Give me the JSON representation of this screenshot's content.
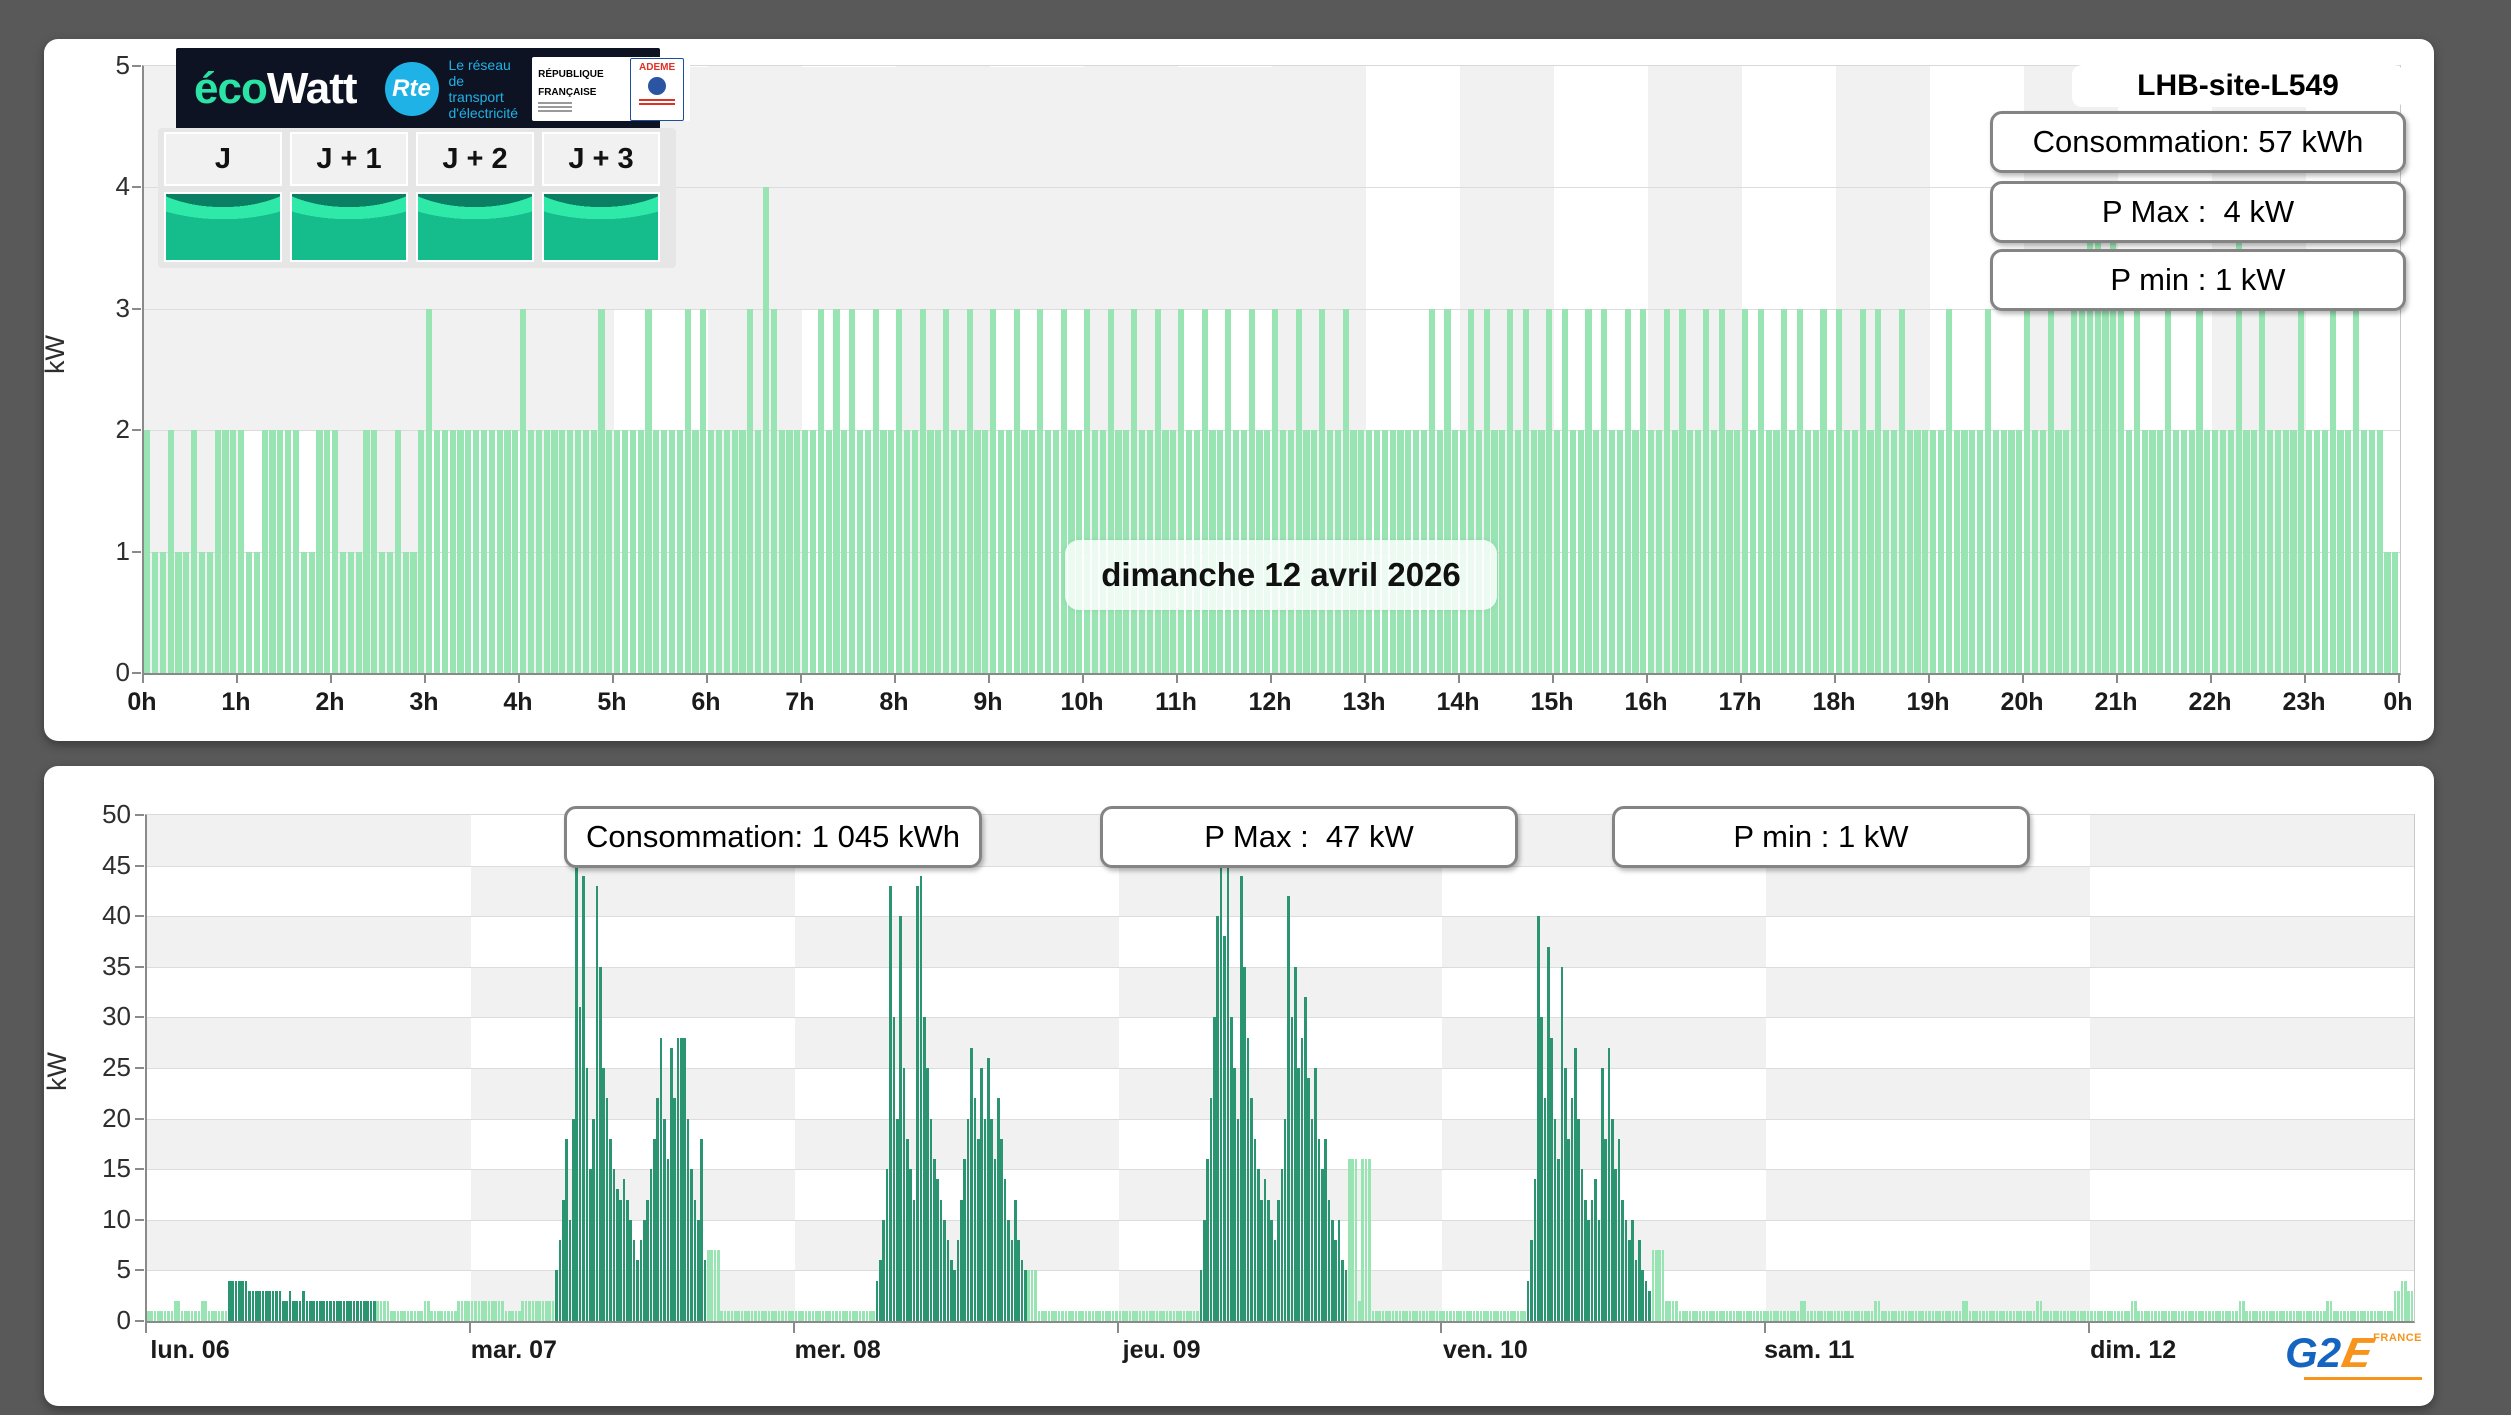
{
  "colors": {
    "page_background": "#595959",
    "panel_background": "#ffffff",
    "checker_gray": "#f1f1f1",
    "bar_light_green": "#98e5b3",
    "bar_dark_green": "#2a9570",
    "axis_gray": "#8a8a8a",
    "logo_navy": "#0d1322",
    "logo_green": "#2be3a4",
    "rte_blue": "#1fb2e6",
    "g2e_blue": "#1565c0",
    "g2e_orange": "#f6941e"
  },
  "header": {
    "logo": {
      "eco": "éco",
      "watt": "Watt",
      "rte": "Rte",
      "network": "Le réseau de transport d'électricité",
      "republique": "RÉPUBLIQUE FRANÇAISE",
      "ademe": "ADEME"
    },
    "day_buttons": [
      "J",
      "J + 1",
      "J + 2",
      "J + 3"
    ]
  },
  "day_panel": {
    "site_title": "LHB-site-L549",
    "stats": [
      "Consommation: 57 kWh",
      "P Max :  4 kW",
      "P min : 1 kW"
    ],
    "date_label": "dimanche 12 avril 2026"
  },
  "week_panel": {
    "stats": [
      "Consommation: 1 045 kWh",
      "P Max :  47 kW",
      "P min : 1 kW"
    ]
  },
  "footer_logo": {
    "g2": "G2",
    "e": "E",
    "france": "FRANCE"
  },
  "chart_data": [
    {
      "type": "bar",
      "title": "dimanche 12 avril 2026",
      "ylabel": "kW",
      "ylim": [
        0,
        5
      ],
      "grid": "hour-stripes",
      "interval_minutes": 5,
      "x_tick_labels": [
        "0h",
        "1h",
        "2h",
        "3h",
        "4h",
        "5h",
        "6h",
        "7h",
        "8h",
        "9h",
        "10h",
        "11h",
        "12h",
        "13h",
        "14h",
        "15h",
        "16h",
        "17h",
        "18h",
        "19h",
        "20h",
        "21h",
        "22h",
        "23h",
        "0h"
      ],
      "y_tick_labels": [
        "0",
        "1",
        "2",
        "3",
        "4",
        "5"
      ],
      "stats": {
        "consumption_kwh": 57,
        "p_max_kw": 4,
        "p_min_kw": 1
      },
      "series_rle": [
        [
          1,
          2
        ],
        [
          2,
          1
        ],
        [
          1,
          2
        ],
        [
          2,
          1
        ],
        [
          1,
          2
        ],
        [
          2,
          1
        ],
        [
          4,
          2
        ],
        [
          2,
          1
        ],
        [
          5,
          2
        ],
        [
          2,
          1
        ],
        [
          2,
          2
        ],
        [
          1,
          2
        ],
        [
          3,
          1
        ],
        [
          2,
          2
        ],
        [
          2,
          1
        ],
        [
          1,
          2
        ],
        [
          2,
          1
        ],
        [
          1,
          2
        ],
        [
          1,
          3
        ],
        [
          1,
          2
        ],
        [
          10,
          2
        ],
        [
          1,
          3
        ],
        [
          9,
          2
        ],
        [
          1,
          3
        ],
        [
          5,
          2
        ],
        [
          1,
          3
        ],
        [
          4,
          2
        ],
        [
          1,
          3
        ],
        [
          1,
          2
        ],
        [
          1,
          3
        ],
        [
          5,
          2
        ],
        [
          1,
          3
        ],
        [
          1,
          2
        ],
        [
          1,
          4
        ],
        [
          1,
          3
        ],
        [
          5,
          2
        ],
        [
          1,
          3
        ],
        [
          1,
          2
        ],
        [
          1,
          3
        ],
        [
          1,
          2
        ],
        {
          "rep": 22,
          "seq": [
            [
              1,
              3
            ],
            [
              2,
              2
            ]
          ]
        },
        [
          8,
          2
        ],
        {
          "rep": 12,
          "seq": [
            [
              1,
              3
            ],
            [
              1,
              2
            ],
            [
              1,
              3
            ],
            [
              2,
              2
            ]
          ]
        },
        [
          1,
          3
        ],
        [
          3,
          2
        ],
        [
          2,
          2
        ],
        [
          1,
          3
        ],
        [
          4,
          2
        ],
        [
          1,
          3
        ],
        [
          4,
          2
        ],
        [
          1,
          3
        ],
        [
          2,
          2
        ],
        [
          1,
          3
        ],
        [
          2,
          2
        ],
        [
          2,
          3
        ],
        [
          2,
          4
        ],
        [
          1,
          3
        ],
        [
          1,
          4
        ],
        [
          1,
          3
        ],
        [
          1,
          2
        ],
        [
          1,
          3
        ],
        [
          3,
          2
        ],
        [
          1,
          3
        ],
        [
          3,
          2
        ],
        [
          1,
          3
        ],
        [
          4,
          2
        ],
        [
          1,
          4
        ],
        [
          2,
          2
        ],
        [
          1,
          3
        ],
        [
          4,
          2
        ],
        [
          1,
          3
        ],
        [
          3,
          2
        ],
        [
          1,
          3
        ],
        [
          2,
          2
        ],
        [
          1,
          3
        ],
        [
          3,
          2
        ],
        [
          2,
          1
        ]
      ]
    },
    {
      "type": "bar",
      "ylabel": "kW",
      "ylim": [
        0,
        50
      ],
      "grid": "checkerboard-day-5kw",
      "interval_minutes": 15,
      "x_tick_labels": [
        "lun. 06",
        "mar. 07",
        "mer. 08",
        "jeu. 09",
        "ven. 10",
        "sam. 11",
        "dim. 12"
      ],
      "y_tick_labels": [
        "0",
        "5",
        "10",
        "15",
        "20",
        "25",
        "30",
        "35",
        "40",
        "45",
        "50"
      ],
      "stats": {
        "consumption_kwh": 1045,
        "p_max_kw": 47,
        "p_min_kw": 1
      },
      "series_rle": [
        [
          8,
          1,
          "l"
        ],
        [
          2,
          2,
          "l"
        ],
        [
          6,
          1,
          "l"
        ],
        [
          2,
          2,
          "l"
        ],
        [
          6,
          1,
          "l"
        ],
        [
          6,
          4,
          "d"
        ],
        [
          10,
          3,
          "d"
        ],
        [
          2,
          2,
          "d"
        ],
        [
          1,
          3,
          "d"
        ],
        [
          3,
          2,
          "d"
        ],
        [
          1,
          3,
          "d"
        ],
        [
          1,
          2,
          "d"
        ],
        [
          20,
          2,
          "d"
        ],
        [
          4,
          2,
          "l"
        ],
        [
          10,
          1,
          "l"
        ],
        [
          2,
          2,
          "l"
        ],
        [
          8,
          1,
          "l"
        ],
        [
          4,
          2,
          "l"
        ],
        [
          10,
          2,
          "l"
        ],
        [
          5,
          1,
          "l"
        ],
        [
          10,
          2,
          "l"
        ],
        {
          "c": "d",
          "vals": [
            5,
            8,
            12,
            18,
            10,
            20,
            45,
            31,
            44,
            25,
            15,
            20,
            43,
            35,
            25,
            22,
            18,
            15,
            13,
            12,
            14,
            12,
            10,
            8,
            6,
            8,
            10,
            12,
            15,
            18,
            22,
            28,
            20,
            16,
            27,
            22,
            28,
            28,
            28,
            20,
            15,
            12,
            10,
            18,
            6
          ]
        },
        [
          4,
          7,
          "l"
        ],
        [
          22,
          1,
          "l"
        ],
        [
          24,
          1,
          "l"
        ],
        {
          "c": "d",
          "vals": [
            4,
            6,
            10,
            15,
            43,
            30,
            20,
            40,
            25,
            18,
            15,
            12,
            43,
            44,
            30,
            25,
            20,
            16,
            14,
            12,
            10,
            8,
            6,
            5,
            8,
            12,
            16,
            20,
            27,
            22,
            18,
            25,
            20,
            26,
            20,
            16,
            22,
            18,
            14,
            10,
            8,
            12,
            8,
            6,
            5
          ]
        },
        [
          3,
          5,
          "l"
        ],
        [
          24,
          1,
          "l"
        ],
        [
          24,
          1,
          "l"
        ],
        {
          "c": "d",
          "vals": [
            5,
            10,
            16,
            22,
            30,
            40,
            47,
            38,
            46,
            30,
            25,
            20,
            44,
            35,
            28,
            22,
            18,
            15,
            12,
            14,
            12,
            10,
            8,
            12,
            15,
            20,
            42,
            30,
            35,
            25,
            28,
            32,
            24,
            20,
            25,
            18,
            15,
            18,
            12,
            10,
            8,
            10,
            6,
            5
          ]
        },
        [
          3,
          16,
          "l"
        ],
        [
          1,
          2,
          "l"
        ],
        [
          3,
          16,
          "l"
        ],
        [
          21,
          1,
          "l"
        ],
        [
          25,
          1,
          "l"
        ],
        {
          "c": "d",
          "vals": [
            4,
            8,
            14,
            40,
            30,
            22,
            37,
            28,
            20,
            16,
            35,
            25,
            18,
            22,
            27,
            20,
            15,
            12,
            10,
            12,
            14,
            10,
            25,
            18,
            27,
            20,
            15,
            18,
            12,
            10,
            8,
            10,
            6,
            8,
            5,
            4,
            3
          ]
        },
        [
          4,
          7,
          "l"
        ],
        [
          4,
          2,
          "l"
        ],
        [
          26,
          1,
          "l"
        ],
        [
          10,
          1,
          "l"
        ],
        [
          2,
          2,
          "l"
        ],
        [
          20,
          1,
          "l"
        ],
        [
          2,
          2,
          "l"
        ],
        [
          24,
          1,
          "l"
        ],
        [
          2,
          2,
          "l"
        ],
        [
          20,
          1,
          "l"
        ],
        [
          2,
          2,
          "l"
        ],
        [
          14,
          1,
          "l"
        ],
        [
          12,
          1,
          "l"
        ],
        [
          2,
          2,
          "l"
        ],
        [
          30,
          1,
          "l"
        ],
        [
          2,
          2,
          "l"
        ],
        [
          24,
          1,
          "l"
        ],
        [
          2,
          2,
          "l"
        ],
        [
          18,
          1,
          "l"
        ],
        [
          2,
          3,
          "l"
        ],
        [
          2,
          4,
          "l"
        ],
        [
          2,
          3,
          "l"
        ]
      ]
    }
  ]
}
